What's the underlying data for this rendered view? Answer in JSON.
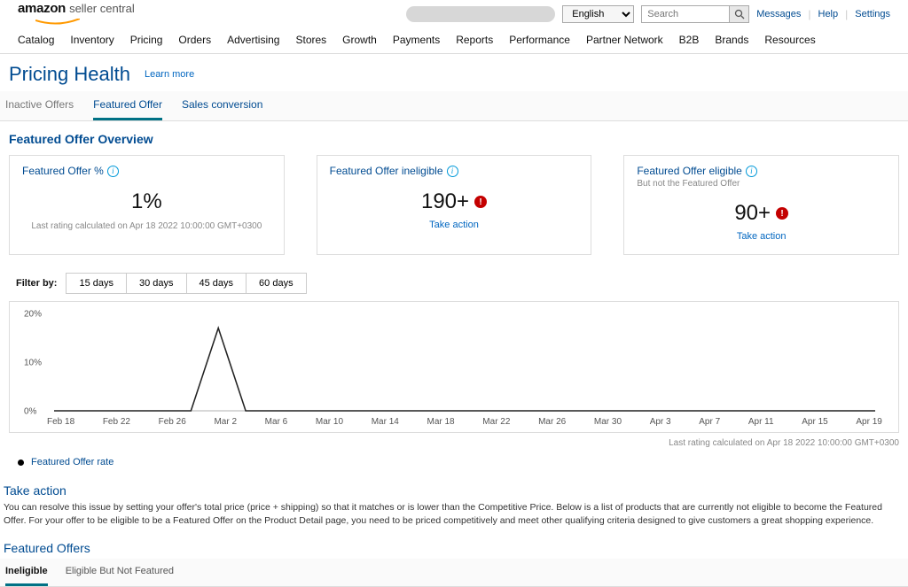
{
  "header": {
    "logo_main": "amazon",
    "logo_sub": "seller central",
    "lang": "English",
    "search_placeholder": "Search",
    "links": {
      "messages": "Messages",
      "help": "Help",
      "settings": "Settings"
    }
  },
  "nav": [
    "Catalog",
    "Inventory",
    "Pricing",
    "Orders",
    "Advertising",
    "Stores",
    "Growth",
    "Payments",
    "Reports",
    "Performance",
    "Partner Network",
    "B2B",
    "Brands",
    "Resources"
  ],
  "page": {
    "title": "Pricing Health",
    "learn_more": "Learn more"
  },
  "subnav": {
    "inactive": "Inactive Offers",
    "featured": "Featured Offer",
    "sales": "Sales conversion"
  },
  "overview": {
    "title": "Featured Offer Overview",
    "card1": {
      "title": "Featured Offer %",
      "value": "1%",
      "footer": "Last rating calculated on Apr 18 2022 10:00:00 GMT+0300"
    },
    "card2": {
      "title": "Featured Offer ineligible",
      "value": "190+",
      "action": "Take action"
    },
    "card3": {
      "title": "Featured Offer eligible",
      "sub": "But not the Featured Offer",
      "value": "90+",
      "action": "Take action"
    }
  },
  "filter": {
    "label": "Filter by:",
    "btns": [
      "15 days",
      "30 days",
      "45 days",
      "60 days"
    ]
  },
  "chart_data": {
    "type": "line",
    "ylabel": "",
    "ylim": [
      0,
      20
    ],
    "y_ticks": [
      "0%",
      "10%",
      "20%"
    ],
    "categories": [
      "Feb 18",
      "Feb 22",
      "Feb 26",
      "Mar 2",
      "Mar 6",
      "Mar 10",
      "Mar 14",
      "Mar 18",
      "Mar 22",
      "Mar 26",
      "Mar 30",
      "Apr 3",
      "Apr 7",
      "Apr 11",
      "Apr 15",
      "Apr 19"
    ],
    "series": [
      {
        "name": "Featured Offer rate",
        "values": [
          0,
          0,
          0,
          0,
          0,
          0,
          17,
          0,
          0,
          0,
          0,
          0,
          0,
          0,
          0,
          0,
          0,
          0,
          0,
          0,
          0,
          0,
          0,
          0,
          0,
          0,
          0,
          0,
          0,
          0,
          0
        ]
      }
    ],
    "footer": "Last rating calculated on Apr 18 2022 10:00:00 GMT+0300",
    "legend": "Featured Offer rate"
  },
  "take_action": {
    "title": "Take action",
    "text": "You can resolve this issue by setting your offer's total price (price + shipping) so that it matches or is lower than the Competitive Price. Below is a list of products that are currently not eligible to become the Featured Offer. For your offer to be eligible to be a Featured Offer on the Product Detail page, you need to be priced competitively and meet other qualifying criteria designed to give customers a great shopping experience."
  },
  "featured_offers": {
    "title": "Featured Offers",
    "tabs": {
      "ineligible": "Ineligible",
      "eligible": "Eligible But Not Featured"
    }
  }
}
